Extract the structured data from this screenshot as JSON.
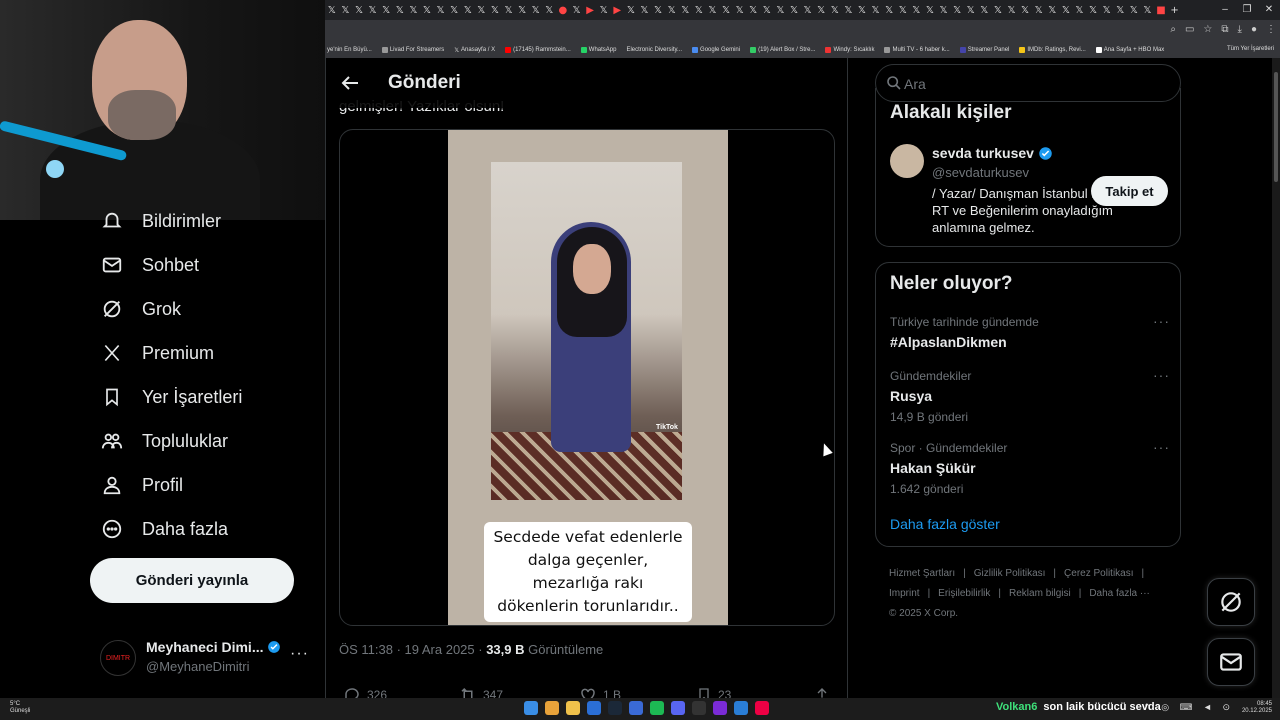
{
  "browser": {
    "bookmarks": [
      "ye'nin En Büyü...",
      "Livad For Streamers",
      "Anasayfa / X",
      "(17145) Rammstein...",
      "WhatsApp",
      "Electronic Diversity...",
      "Google Gemini",
      "(19) Alert Box / Stre...",
      "Windy: Sıcaklık",
      "Multi TV - 6 haber k...",
      "Streamer Panel",
      "IMDb: Ratings, Revi...",
      "Ana Sayfa + HBO Max"
    ],
    "all_bookmarks": "Tüm Yer İşaretleri"
  },
  "nav": {
    "items": [
      {
        "label": "Bildirimler",
        "icon": "bell-icon"
      },
      {
        "label": "Sohbet",
        "icon": "mail-icon"
      },
      {
        "label": "Grok",
        "icon": "grok-icon"
      },
      {
        "label": "Premium",
        "icon": "x-logo-icon"
      },
      {
        "label": "Yer İşaretleri",
        "icon": "bookmark-icon"
      },
      {
        "label": "Topluluklar",
        "icon": "people-icon"
      },
      {
        "label": "Profil",
        "icon": "person-icon"
      },
      {
        "label": "Daha fazla",
        "icon": "more-circle-icon"
      }
    ],
    "post_button": "Gönderi yayınla",
    "profile": {
      "name": "Meyhaneci Dimi...",
      "handle": "@MeyhaneDimitri",
      "avatar_text": "DIMITR"
    }
  },
  "main": {
    "title": "Gönderi",
    "post_text": "gelmişler! Yazıklar olsun!",
    "video_watermark": "TikTok",
    "caption": "Secdede vefat edenlerle dalga geçenler, mezarlığa rakı dökenlerin torunlarıdır..",
    "meta": {
      "time": "ÖS 11:38 · 19 Ara 2025 · ",
      "views": "33,9 B",
      "views_label": " Görüntüleme"
    },
    "actions": {
      "replies": "326",
      "reposts": "347",
      "likes": "1 B",
      "bookmarks": "23"
    }
  },
  "sidebar": {
    "search_placeholder": "Ara",
    "related": {
      "title": "Alakalı kişiler",
      "name": "sevda turkusev",
      "handle": "@sevdaturkusev",
      "bio": "/ Yazar/ Danışman İstanbul Bosna ... RT ve Beğenilerim onayladığım anlamına gelmez.",
      "follow": "Takip et"
    },
    "trends": {
      "title": "Neler oluyor?",
      "items": [
        {
          "category": "Türkiye tarihinde gündemde",
          "name": "#AlpaslanDikmen",
          "count": ""
        },
        {
          "category": "Gündemdekiler",
          "name": "Rusya",
          "count": "14,9 B gönderi"
        },
        {
          "category": "Spor · Gündemdekiler",
          "name": "Hakan Şükür",
          "count": "1.642 gönderi"
        }
      ],
      "show_more": "Daha fazla göster"
    },
    "footer": [
      "Hizmet Şartları",
      "|",
      "Gizlilik Politikası",
      "|",
      "Çerez Politikası",
      "|",
      "Imprint",
      "|",
      "Erişilebilirlik",
      "|",
      "Reklam bilgisi",
      "|",
      "Daha fazla ···",
      "© 2025 X Corp."
    ]
  },
  "taskbar": {
    "weather": "5°C",
    "weather_desc": "Güneşli",
    "ticker_user": "Volkan6",
    "ticker_msg": "son laik bücücü sevda",
    "time": "08:45",
    "date": "20.12.2025"
  },
  "colors": {
    "accent": "#1d9bf0",
    "verified": "#1d9bf0",
    "bg": "#000000"
  }
}
